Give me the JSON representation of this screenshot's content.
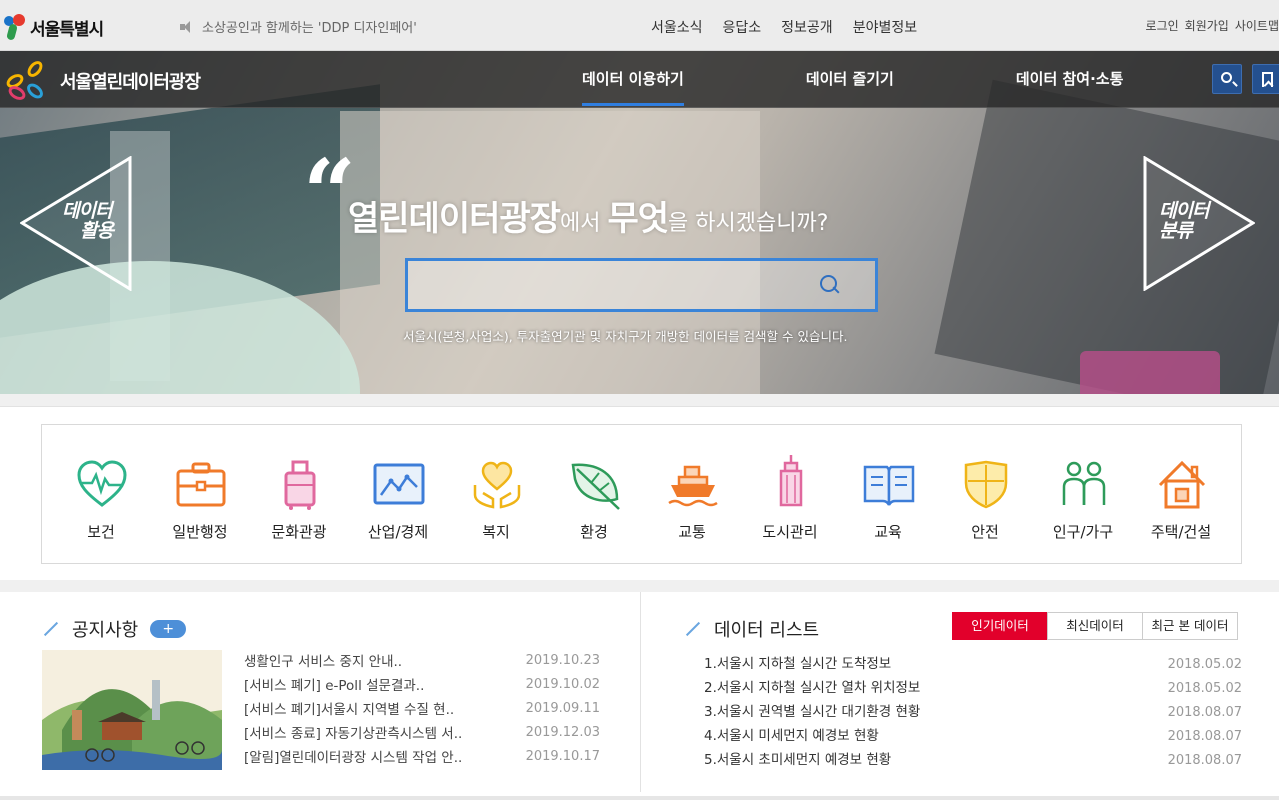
{
  "gov": {
    "logo_text": "서울특별시",
    "notice": "소상공인과 함께하는 'DDP 디자인페어'",
    "links": [
      "서울소식",
      "응답소",
      "정보공개",
      "분야별정보"
    ],
    "util": [
      "로그인",
      "회원가입",
      "사이트맵"
    ]
  },
  "nav": {
    "brand": "서울열린데이터광장",
    "menu": [
      "데이터 이용하기",
      "데이터 즐기기",
      "데이터 참여·소통"
    ],
    "active_index": 0,
    "accent": "#2f7ee0"
  },
  "hero": {
    "headline_big1": "열린데이터광장",
    "headline_small1": "에서 ",
    "headline_big2": "무엇",
    "headline_small2": "을 하시겠습니까?",
    "search_value": "",
    "subtext": "서울시(본청,사업소), 투자출연기관 및 자치구가 개방한 데이터를 검색할 수 있습니다.",
    "left_arrow": [
      "데이터",
      "활용"
    ],
    "right_arrow": [
      "데이터",
      "분류"
    ]
  },
  "categories": [
    {
      "label": "보건",
      "icon": "heart-pulse-icon"
    },
    {
      "label": "일반행정",
      "icon": "briefcase-icon"
    },
    {
      "label": "문화관광",
      "icon": "luggage-icon"
    },
    {
      "label": "산업/경제",
      "icon": "line-chart-icon"
    },
    {
      "label": "복지",
      "icon": "heart-hands-icon"
    },
    {
      "label": "환경",
      "icon": "leaf-icon"
    },
    {
      "label": "교통",
      "icon": "ship-icon"
    },
    {
      "label": "도시관리",
      "icon": "building-icon"
    },
    {
      "label": "교육",
      "icon": "book-icon"
    },
    {
      "label": "안전",
      "icon": "shield-icon"
    },
    {
      "label": "인구/가구",
      "icon": "people-icon"
    },
    {
      "label": "주택/건설",
      "icon": "house-icon"
    }
  ],
  "notice": {
    "title": "공지사항",
    "more": "+",
    "items": [
      {
        "title": "생활인구 서비스 중지 안내..",
        "date": "2019.10.23"
      },
      {
        "title": "[서비스 폐기] e-Poll 설문결과..",
        "date": "2019.10.02"
      },
      {
        "title": "[서비스 폐기]서울시 지역별 수질 현..",
        "date": "2019.09.11"
      },
      {
        "title": "[서비스 종료] 자동기상관측시스템 서..",
        "date": "2019.12.03"
      },
      {
        "title": "[알림]열린데이터광장 시스템 작업 안..",
        "date": "2019.10.17"
      }
    ]
  },
  "datalist": {
    "title": "데이터 리스트",
    "tabs": [
      "인기데이터",
      "최신데이터",
      "최근 본 데이터"
    ],
    "active_tab": 0,
    "items": [
      {
        "title": "1.서울시 지하철 실시간 도착정보",
        "date": "2018.05.02"
      },
      {
        "title": "2.서울시 지하철 실시간 열차 위치정보",
        "date": "2018.05.02"
      },
      {
        "title": "3.서울시 권역별 실시간 대기환경 현황",
        "date": "2018.08.07"
      },
      {
        "title": "4.서울시 미세먼지 예경보 현황",
        "date": "2018.08.07"
      },
      {
        "title": "5.서울시 초미세먼지 예경보 현황",
        "date": "2018.08.07"
      }
    ]
  }
}
